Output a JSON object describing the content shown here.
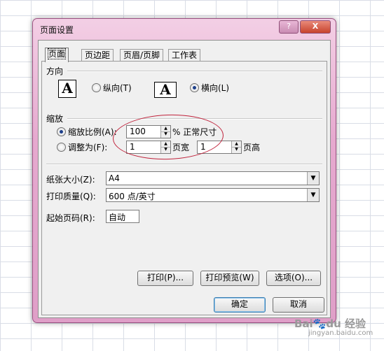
{
  "window": {
    "title": "页面设置",
    "help": "?",
    "close": "X"
  },
  "tabs": [
    "页面",
    "页边距",
    "页眉/页脚",
    "工作表"
  ],
  "orientation": {
    "group": "方向",
    "portrait": "纵向(T)",
    "landscape": "横向(L)",
    "icon_letter": "A",
    "selected": "landscape"
  },
  "scaling": {
    "group": "缩放",
    "adjust_label": "缩放比例(A):",
    "adjust_value": "100",
    "percent_suffix": "% 正常尺寸",
    "fit_label": "调整为(F):",
    "fit_wide_value": "1",
    "wide_suffix": "页宽",
    "fit_tall_value": "1",
    "tall_suffix": "页高",
    "selected": "adjust"
  },
  "paper_size": {
    "label": "纸张大小(Z):",
    "value": "A4"
  },
  "print_quality": {
    "label": "打印质量(Q):",
    "value": "600 点/英寸"
  },
  "first_page": {
    "label": "起始页码(R):",
    "value": "自动"
  },
  "buttons": {
    "print": "打印(P)...",
    "preview": "打印预览(W)",
    "options": "选项(O)...",
    "ok": "确定",
    "cancel": "取消"
  },
  "watermark": {
    "brand": "Bai",
    "paw": "du",
    "tail": "经验",
    "sub": "jingyan.baidu.com"
  }
}
